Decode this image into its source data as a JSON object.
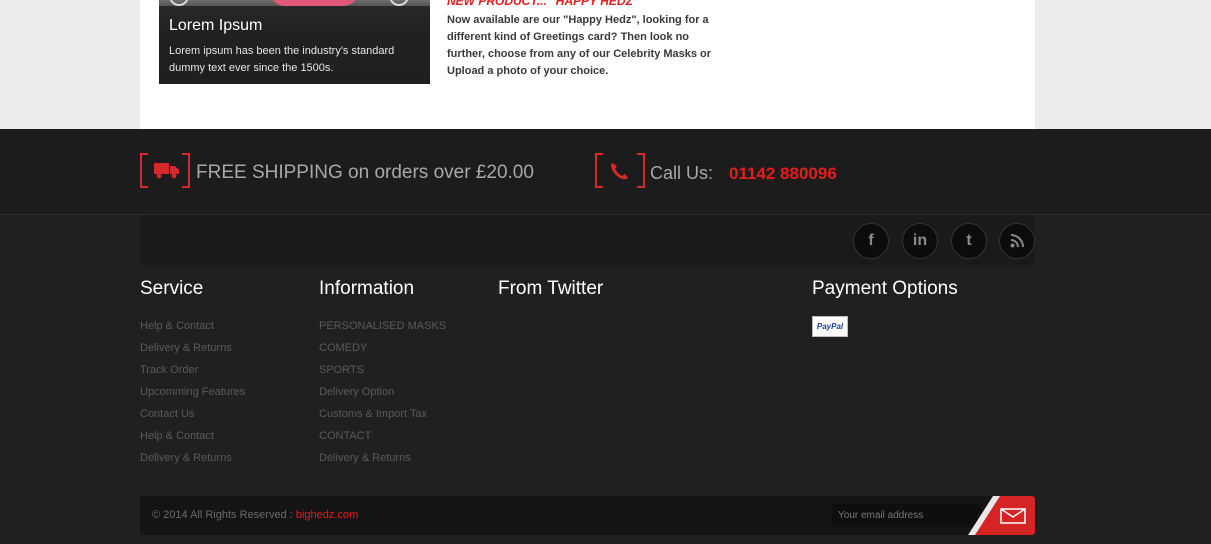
{
  "promo": {
    "title": "Lorem Ipsum",
    "text": "Lorem ipsum has been the industry's standard dummy text ever since the 1500s."
  },
  "news": {
    "heading": "NEW PRODUCT...   \"HAPPY HEDZ\"",
    "text": "Now available are our \"Happy Hedz\", looking for a different kind of Greetings card?  Then look no further, choose from any of our Celebrity Masks or Upload a photo of your choice."
  },
  "strip": {
    "shipping": "FREE SHIPPING on orders over £20.00",
    "call_label": "Call Us:",
    "phone": "01142 880096",
    "truck_icon": "truck-icon",
    "phone_icon": "phone-icon"
  },
  "social": [
    "facebook-icon",
    "linkedin-icon",
    "twitter-icon",
    "rss-icon"
  ],
  "footer": {
    "service_title": "Service",
    "service_items": [
      "Help & Contact",
      "Delivery & Returns",
      "Track Order",
      "Upcomming Features",
      "Contact Us",
      "Help & Contact",
      "Delivery & Returns"
    ],
    "info_title": "Information",
    "info_items": [
      "PERSONALISED MASKS",
      "COMEDY",
      "SPORTS",
      "Delivery Option",
      "Customs & Import Tax",
      "CONTACT",
      "Delivery & Returns"
    ],
    "twitter_title": "From Twitter",
    "payment_title": "Payment Options",
    "paypal": "PayPal"
  },
  "bottom": {
    "copyright": "© 2014 All Rights Reserved :",
    "site": "bighedz.com",
    "email_placeholder": "Your email address"
  },
  "colors": {
    "accent": "#e51c1c",
    "background": "#202020"
  }
}
